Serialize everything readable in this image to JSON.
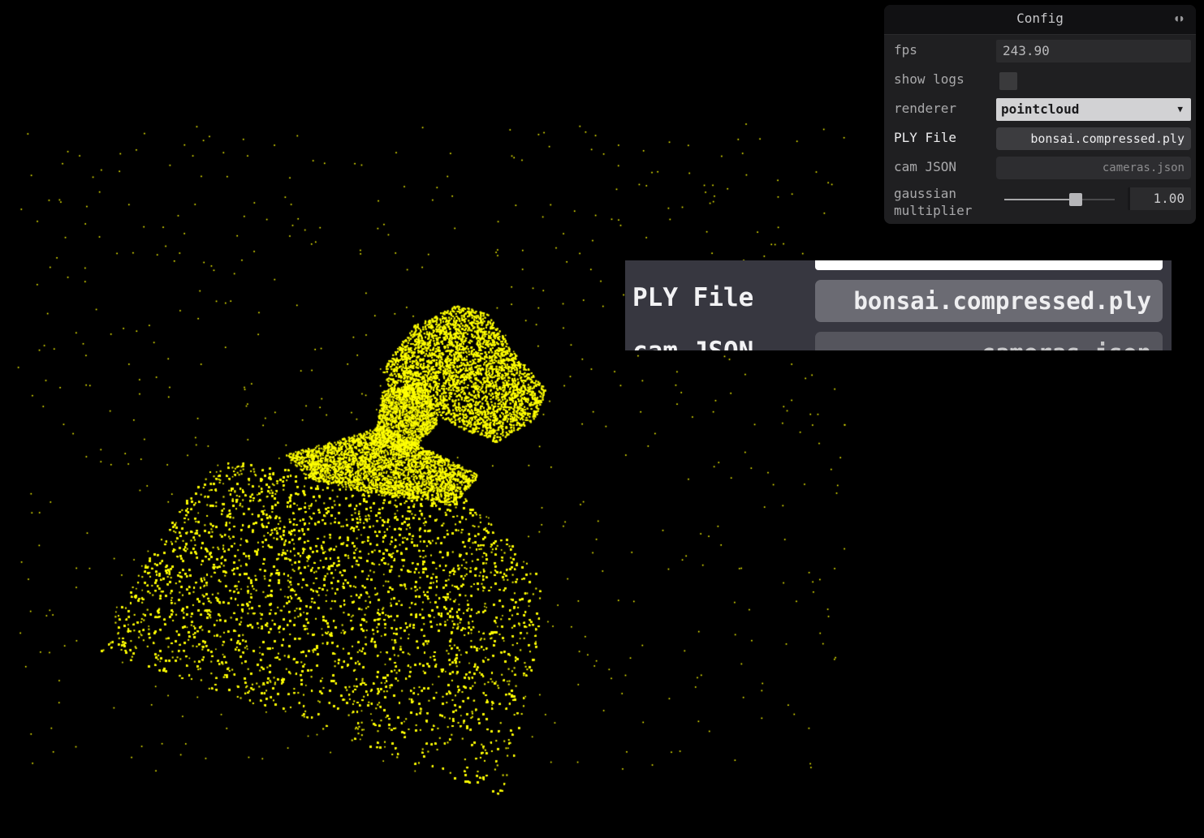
{
  "viewport": {
    "description_icon": "pointcloud-bonsai",
    "point_color": "#ffff00",
    "background_color": "#000000"
  },
  "gui": {
    "title": "Config",
    "collapse_icon": "collapse-icon",
    "rows": {
      "fps": {
        "label": "fps",
        "value": "243.90"
      },
      "show_logs": {
        "label": "show logs",
        "checked": false
      },
      "renderer": {
        "label": "renderer",
        "value": "pointcloud"
      },
      "ply_file": {
        "label": "PLY File",
        "value": "bonsai.compressed.ply"
      },
      "cam_json": {
        "label": "cam JSON",
        "value": "cameras.json"
      },
      "gaussian_multiplier": {
        "label": "gaussian multiplier",
        "value": "1.00",
        "slider_fraction": 0.65
      }
    }
  },
  "zoom": {
    "ply_label": "PLY File",
    "ply_value": "bonsai.compressed.ply",
    "cam_label": "cam JSON",
    "cam_value": "cameras.json"
  }
}
